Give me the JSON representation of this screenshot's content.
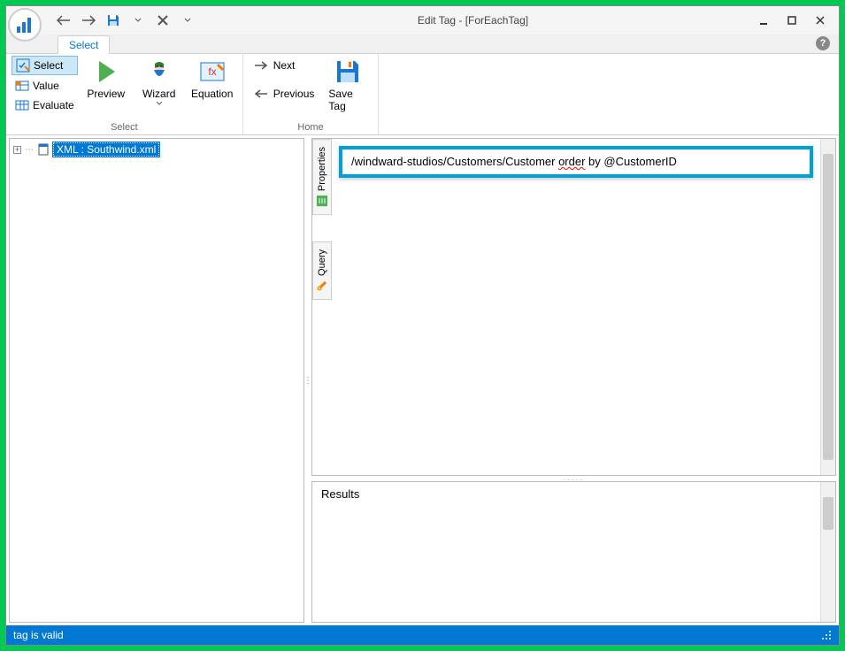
{
  "window": {
    "title": "Edit Tag - [ForEachTag]"
  },
  "tabs": {
    "select": "Select"
  },
  "ribbon": {
    "group_select_label": "Select",
    "group_home_label": "Home",
    "btn_select": "Select",
    "btn_value": "Value",
    "btn_evaluate": "Evaluate",
    "btn_preview": "Preview",
    "btn_wizard": "Wizard",
    "btn_equation": "Equation",
    "btn_next": "Next",
    "btn_previous": "Previous",
    "btn_save_tag": "Save Tag"
  },
  "tree": {
    "root_label": "XML : Southwind.xml"
  },
  "side_tabs": {
    "properties": "Properties",
    "query": "Query"
  },
  "editor": {
    "query_prefix": "/windward-studios/Customers/Customer ",
    "query_word": "order",
    "query_suffix": " by @CustomerID"
  },
  "results": {
    "title": "Results"
  },
  "status": {
    "text": "tag is valid"
  }
}
